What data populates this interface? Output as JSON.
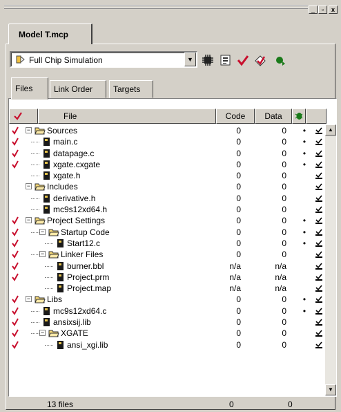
{
  "window": {
    "minimize_glyph": "_",
    "restore_glyph": "▫",
    "close_glyph": "x"
  },
  "document_tab": "Model T.mcp",
  "target": {
    "selected": "Full Chip Simulation",
    "icon": "chip-simulation-icon"
  },
  "toolbar": [
    {
      "name": "target-settings-icon"
    },
    {
      "name": "synchronize-icon"
    },
    {
      "name": "make-icon"
    },
    {
      "name": "debug-icon"
    },
    {
      "name": "run-icon"
    }
  ],
  "tabs": [
    "Files",
    "Link Order",
    "Targets"
  ],
  "columns": {
    "file": "File",
    "code": "Code",
    "data": "Data"
  },
  "rows": [
    {
      "name": "Sources",
      "type": "folder",
      "depth": 0,
      "checked": true,
      "code": "0",
      "data": "0",
      "dot": true,
      "expand": "−"
    },
    {
      "name": "main.c",
      "type": "file",
      "depth": 1,
      "checked": true,
      "code": "0",
      "data": "0",
      "dot": true
    },
    {
      "name": "datapage.c",
      "type": "file",
      "depth": 1,
      "checked": true,
      "code": "0",
      "data": "0",
      "dot": true
    },
    {
      "name": "xgate.cxgate",
      "type": "file",
      "depth": 1,
      "checked": true,
      "code": "0",
      "data": "0",
      "dot": true
    },
    {
      "name": "xgate.h",
      "type": "file",
      "depth": 1,
      "checked": false,
      "code": "0",
      "data": "0",
      "dot": false
    },
    {
      "name": "Includes",
      "type": "folder",
      "depth": 0,
      "checked": false,
      "code": "0",
      "data": "0",
      "dot": false,
      "expand": "−"
    },
    {
      "name": "derivative.h",
      "type": "file",
      "depth": 1,
      "checked": false,
      "code": "0",
      "data": "0",
      "dot": false
    },
    {
      "name": "mc9s12xd64.h",
      "type": "file",
      "depth": 1,
      "checked": false,
      "code": "0",
      "data": "0",
      "dot": false
    },
    {
      "name": "Project Settings",
      "type": "folder",
      "depth": 0,
      "checked": true,
      "code": "0",
      "data": "0",
      "dot": true,
      "expand": "−"
    },
    {
      "name": "Startup Code",
      "type": "folder",
      "depth": 1,
      "checked": true,
      "code": "0",
      "data": "0",
      "dot": true,
      "expand": "−"
    },
    {
      "name": "Start12.c",
      "type": "file",
      "depth": 2,
      "checked": true,
      "code": "0",
      "data": "0",
      "dot": true
    },
    {
      "name": "Linker Files",
      "type": "folder",
      "depth": 1,
      "checked": true,
      "code": "0",
      "data": "0",
      "dot": false,
      "expand": "−"
    },
    {
      "name": "burner.bbl",
      "type": "file",
      "depth": 2,
      "checked": true,
      "code": "n/a",
      "data": "n/a",
      "dot": false
    },
    {
      "name": "Project.prm",
      "type": "file",
      "depth": 2,
      "checked": true,
      "code": "n/a",
      "data": "n/a",
      "dot": false
    },
    {
      "name": "Project.map",
      "type": "file",
      "depth": 2,
      "checked": false,
      "code": "n/a",
      "data": "n/a",
      "dot": false
    },
    {
      "name": "Libs",
      "type": "folder",
      "depth": 0,
      "checked": true,
      "code": "0",
      "data": "0",
      "dot": true,
      "expand": "−"
    },
    {
      "name": "mc9s12xd64.c",
      "type": "file",
      "depth": 1,
      "checked": true,
      "code": "0",
      "data": "0",
      "dot": true
    },
    {
      "name": "ansixsij.lib",
      "type": "file",
      "depth": 1,
      "checked": true,
      "code": "0",
      "data": "0",
      "dot": false
    },
    {
      "name": "XGATE",
      "type": "folder",
      "depth": 1,
      "checked": true,
      "code": "0",
      "data": "0",
      "dot": false,
      "expand": "−"
    },
    {
      "name": "ansi_xgi.lib",
      "type": "file",
      "depth": 2,
      "checked": true,
      "code": "0",
      "data": "0",
      "dot": false
    }
  ],
  "status": {
    "files": "13 files",
    "code_total": "0",
    "data_total": "0"
  },
  "colors": {
    "check": "#c8102e",
    "folder": "#f5d878",
    "file_icon": "#1a1a1a",
    "debug_green": "#1a7a1a"
  }
}
